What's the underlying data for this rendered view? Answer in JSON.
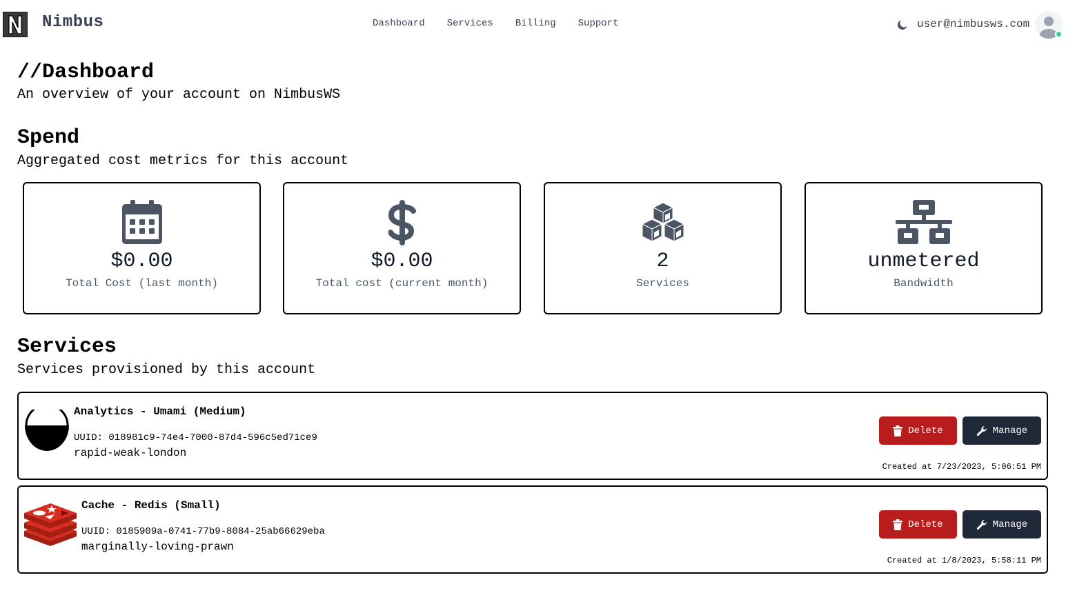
{
  "brand": {
    "name": "Nimbus",
    "logo_letter": "N"
  },
  "nav": {
    "links": [
      "Dashboard",
      "Services",
      "Billing",
      "Support"
    ]
  },
  "user": {
    "email": "user@nimbusws.com",
    "status_color": "#34d399"
  },
  "page": {
    "title": "//Dashboard",
    "subtitle": "An overview of your account on NimbusWS"
  },
  "spend": {
    "title": "Spend",
    "subtitle": "Aggregated cost metrics for this account",
    "cards": [
      {
        "icon": "calendar-icon",
        "value": "$0.00",
        "label": "Total Cost (last month)"
      },
      {
        "icon": "dollar-icon",
        "value": "$0.00",
        "label": "Total cost (current month)"
      },
      {
        "icon": "cubes-icon",
        "value": "2",
        "label": "Services"
      },
      {
        "icon": "network-icon",
        "value": "unmetered",
        "label": "Bandwidth"
      }
    ]
  },
  "services": {
    "title": "Services",
    "subtitle": "Services provisioned by this account",
    "items": [
      {
        "icon": "umami-logo-icon",
        "title": "Analytics - Umami (Medium)",
        "uuid": "UUID: 018981c9-74e4-7000-87d4-596c5ed71ce9",
        "slug": "rapid-weak-london",
        "created": "Created at 7/23/2023, 5:06:51 PM",
        "delete_label": "Delete",
        "manage_label": "Manage"
      },
      {
        "icon": "redis-logo-icon",
        "title": "Cache - Redis (Small)",
        "uuid": "UUID: 0185909a-0741-77b9-8084-25ab66629eba",
        "slug": "marginally-loving-prawn",
        "created": "Created at 1/8/2023, 5:58:11 PM",
        "delete_label": "Delete",
        "manage_label": "Manage"
      }
    ]
  },
  "colors": {
    "delete": "#b91c1c",
    "manage": "#1f2937",
    "icon": "#4b5563",
    "redis": "#c6302b"
  }
}
